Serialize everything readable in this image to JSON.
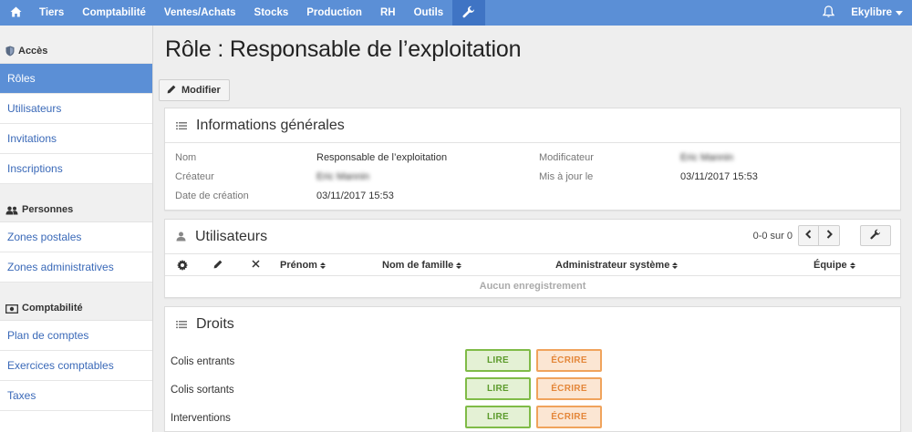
{
  "topbar": {
    "items": [
      "Tiers",
      "Comptabilité",
      "Ventes/Achats",
      "Stocks",
      "Production",
      "RH",
      "Outils"
    ],
    "user": "Ekylibre",
    "colors": {
      "bar": "#5b8fd6",
      "active": "#3f74c4"
    }
  },
  "sidebar": {
    "sections": [
      {
        "title": "Accès",
        "icon": "shield-icon",
        "items": [
          "Rôles",
          "Utilisateurs",
          "Invitations",
          "Inscriptions"
        ]
      },
      {
        "title": "Personnes",
        "icon": "people-icon",
        "items": [
          "Zones postales",
          "Zones administratives"
        ]
      },
      {
        "title": "Comptabilité",
        "icon": "money-icon",
        "items": [
          "Plan de comptes",
          "Exercices comptables",
          "Taxes"
        ]
      }
    ],
    "active": "Rôles"
  },
  "page": {
    "title": "Rôle : Responsable de l’exploitation",
    "edit_button": "Modifier"
  },
  "info": {
    "title": "Informations générales",
    "labels": {
      "name": "Nom",
      "creator": "Créateur",
      "created_at": "Date de création",
      "updater": "Modificateur",
      "updated_at": "Mis à jour le"
    },
    "values": {
      "name": "Responsable de l’exploitation",
      "creator": "Eric Mannin",
      "created_at": "03/11/2017 15:53",
      "updater": "Eric Mannin",
      "updated_at": "03/11/2017 15:53"
    }
  },
  "users": {
    "title": "Utilisateurs",
    "pager": "0-0 sur 0",
    "columns": [
      "Prénom",
      "Nom de famille",
      "Administrateur système",
      "Équipe"
    ],
    "empty": "Aucun enregistrement"
  },
  "rights": {
    "title": "Droits",
    "read_label": "LIRE",
    "write_label": "ÉCRIRE",
    "rows": [
      "Colis entrants",
      "Colis sortants",
      "Interventions"
    ],
    "colors": {
      "read": "#7fbb47",
      "write": "#f0a35c"
    }
  }
}
